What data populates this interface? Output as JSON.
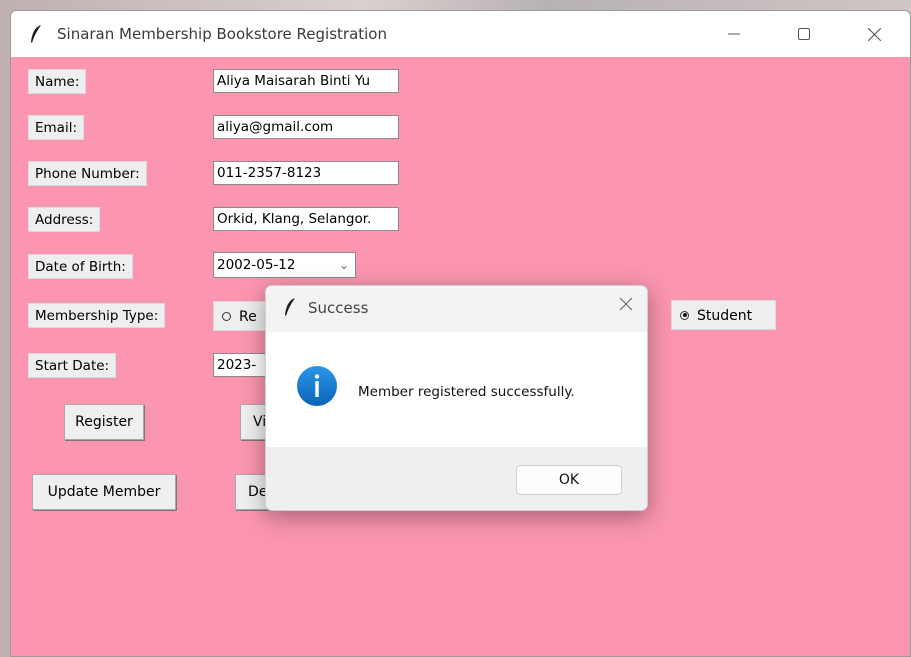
{
  "window": {
    "title": "Sinaran Membership Bookstore Registration",
    "background_color": "#fb95b0"
  },
  "form": {
    "name_label": "Name:",
    "name_value": "Aliya Maisarah Binti Yu",
    "email_label": "Email:",
    "email_value": "aliya@gmail.com",
    "phone_label": "Phone Number:",
    "phone_value": "011-2357-8123",
    "address_label": "Address:",
    "address_value": "Orkid, Klang, Selangor.",
    "dob_label": "Date of Birth:",
    "dob_value": "2002-05-12",
    "membership_label": "Membership Type:",
    "membership_options": [
      "Re",
      "Student"
    ],
    "membership_selected": "Student",
    "start_label": "Start Date:",
    "start_value": "2023-"
  },
  "buttons": {
    "register": "Register",
    "view_partial": "Vi",
    "update": "Update Member",
    "delete_partial": "De"
  },
  "dialog": {
    "title": "Success",
    "message": "Member registered successfully.",
    "ok_label": "OK",
    "icon": "info-icon",
    "icon_color": "#0a74c9"
  }
}
